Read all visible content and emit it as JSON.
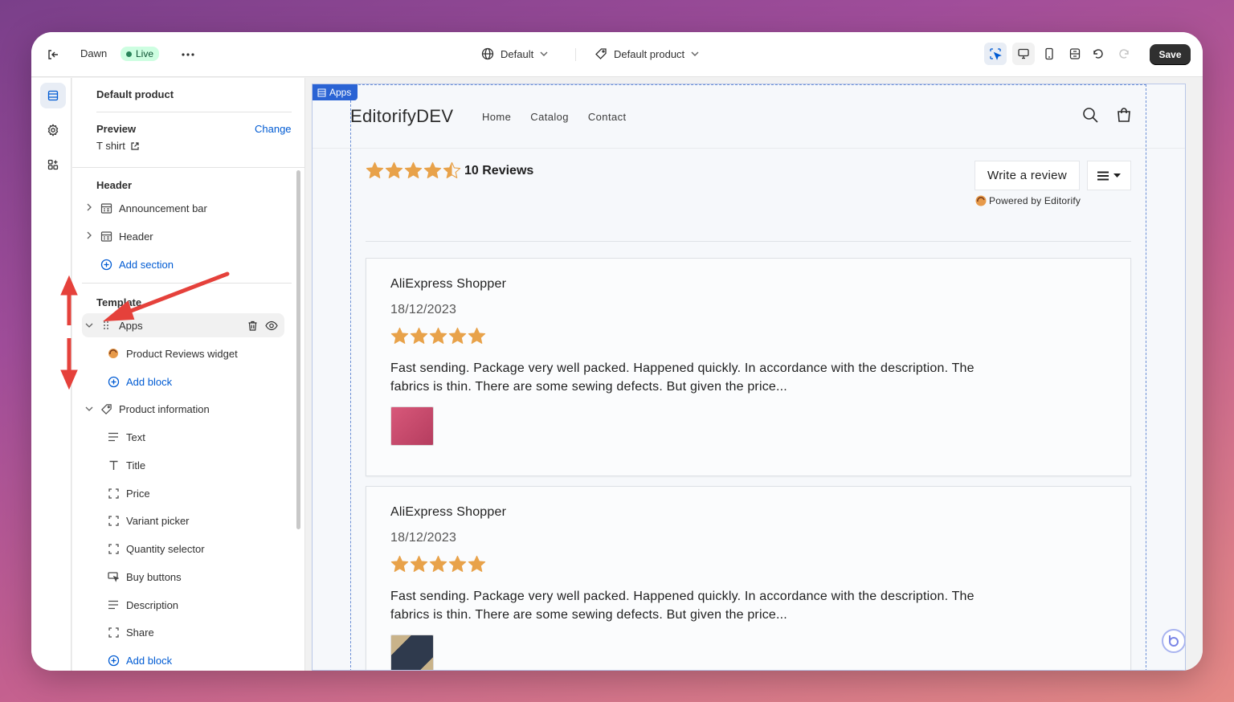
{
  "topbar": {
    "theme_name": "Dawn",
    "status": "Live",
    "locale": "Default",
    "template": "Default product",
    "save_label": "Save"
  },
  "sidebar": {
    "title": "Default product",
    "preview_label": "Preview",
    "change_label": "Change",
    "preview_value": "T shirt",
    "header_section": {
      "label": "Header",
      "items": [
        {
          "label": "Announcement bar",
          "icon": "section-icon"
        },
        {
          "label": "Header",
          "icon": "section-icon"
        }
      ],
      "add_label": "Add section"
    },
    "template_section": {
      "label": "Template",
      "apps": {
        "label": "Apps",
        "blocks": [
          {
            "label": "Product Reviews widget",
            "icon": "app-icon"
          }
        ],
        "add_label": "Add block"
      },
      "product_info": {
        "label": "Product information",
        "blocks": [
          {
            "label": "Text",
            "icon": "text-icon"
          },
          {
            "label": "Title",
            "icon": "title-icon"
          },
          {
            "label": "Price",
            "icon": "block-icon"
          },
          {
            "label": "Variant picker",
            "icon": "block-icon"
          },
          {
            "label": "Quantity selector",
            "icon": "block-icon"
          },
          {
            "label": "Buy buttons",
            "icon": "cursor-icon"
          },
          {
            "label": "Description",
            "icon": "text-icon"
          },
          {
            "label": "Share",
            "icon": "block-icon"
          }
        ],
        "add_label": "Add block"
      }
    }
  },
  "preview": {
    "apps_tag": "Apps",
    "store_name": "EditorifyDEV",
    "nav": [
      "Home",
      "Catalog",
      "Contact"
    ],
    "rating_value": 4.5,
    "reviews_count_label": "10 Reviews",
    "write_review_label": "Write a review",
    "powered_by": "Powered by Editorify",
    "star_color": "#e8a24a",
    "reviews": [
      {
        "author": "AliExpress Shopper",
        "date": "18/12/2023",
        "rating": 5,
        "text": "Fast sending. Package very well packed. Happened quickly. In accordance with the description. The fabrics is thin. There are some sewing defects. But given the price...",
        "thumb_color": "#c94a6c"
      },
      {
        "author": "AliExpress Shopper",
        "date": "18/12/2023",
        "rating": 5,
        "text": "Fast sending. Package very well packed. Happened quickly. In accordance with the description. The fabrics is thin. There are some sewing defects. But given the price...",
        "thumb_color": "#2f3a4d"
      }
    ]
  },
  "annotation_color": "#e5413b"
}
